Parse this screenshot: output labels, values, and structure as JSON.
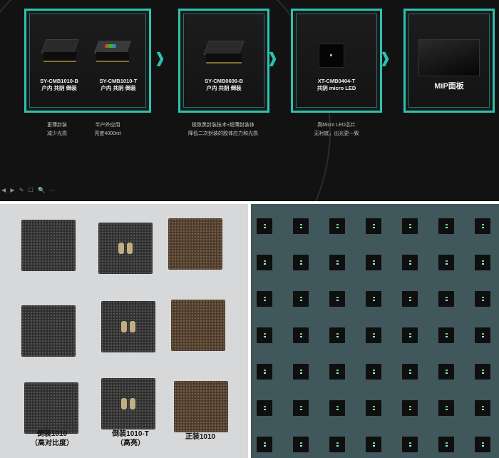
{
  "slide": {
    "cards": [
      {
        "products": [
          {
            "model": "SY-CMB1010-B",
            "desc": "户内 共阴 倒装"
          },
          {
            "model": "SY-CMB1010-T",
            "desc": "户内 共阴 倒装"
          }
        ]
      },
      {
        "products": [
          {
            "model": "SY-CMB0606-B",
            "desc": "户内 共阴 倒装"
          }
        ]
      },
      {
        "products": [
          {
            "model": "XT-CMB0404-T",
            "desc": "共阴 micro LED"
          }
        ]
      },
      {
        "products": [
          {
            "model": "MiP面板",
            "desc": ""
          }
        ]
      }
    ],
    "notes": [
      {
        "lines": [
          "更薄封装",
          "减少光损"
        ]
      },
      {
        "lines": [
          "半户外应用",
          "亮度4000nit"
        ]
      },
      {
        "lines": [
          "极致黑封装技术+超薄封装体",
          "降低二次封装的胶体应力和光损"
        ]
      },
      {
        "lines": [
          "真Micro LED芯片",
          "无衬底，出光更一致"
        ]
      }
    ],
    "arrow_color": "#2cc2b0"
  },
  "photo_left": {
    "captions": [
      {
        "line1": "倒装1010",
        "line2": "（高对比度）"
      },
      {
        "line1": "倒装1010-T",
        "line2": "（高亮）"
      },
      {
        "line1": "正装1010",
        "line2": ""
      }
    ]
  },
  "photo_right": {
    "grid_rows": 7,
    "grid_cols": 7
  }
}
